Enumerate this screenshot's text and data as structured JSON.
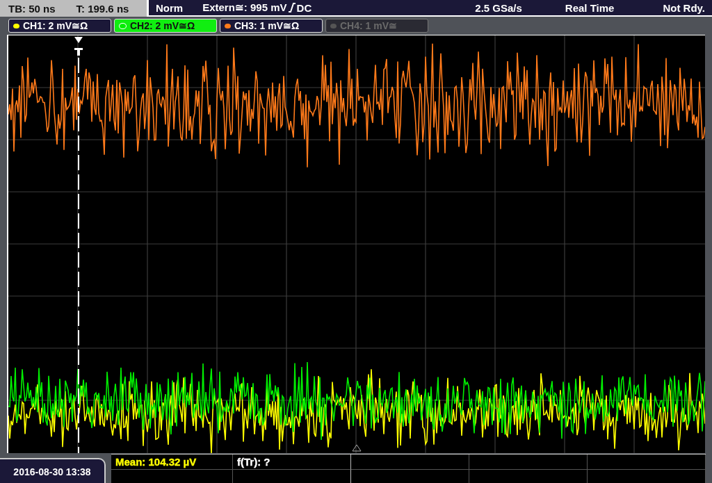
{
  "timebase": {
    "scale": "TB: 50 ns",
    "position": "T: 199.6 ns"
  },
  "trigger": {
    "mode": "Norm",
    "source": "Extern≅: 995 mV",
    "coupling": "DC"
  },
  "acquisition": {
    "sample_rate": "2.5 GSa/s",
    "mode": "Real Time",
    "status": "Not Rdy."
  },
  "channels": [
    {
      "label": "CH1: 2 mV≅Ω",
      "selected": false,
      "enabled": true,
      "color": "#ffff00"
    },
    {
      "label": "CH2: 2 mV≅Ω",
      "selected": true,
      "enabled": true,
      "color": "#00ee00"
    },
    {
      "label": "CH3: 1 mV≅Ω",
      "selected": false,
      "enabled": true,
      "color": "#ff7a1a"
    },
    {
      "label": "CH4: 1 mV≅",
      "selected": false,
      "enabled": false,
      "color": "#555555"
    }
  ],
  "date": "2016-08-30 13:38",
  "measurements": [
    {
      "text": "Mean: 104.32 µV",
      "color": "#ffff00"
    },
    {
      "text": "f(Tr): ?",
      "color": "#ffffff"
    }
  ]
}
